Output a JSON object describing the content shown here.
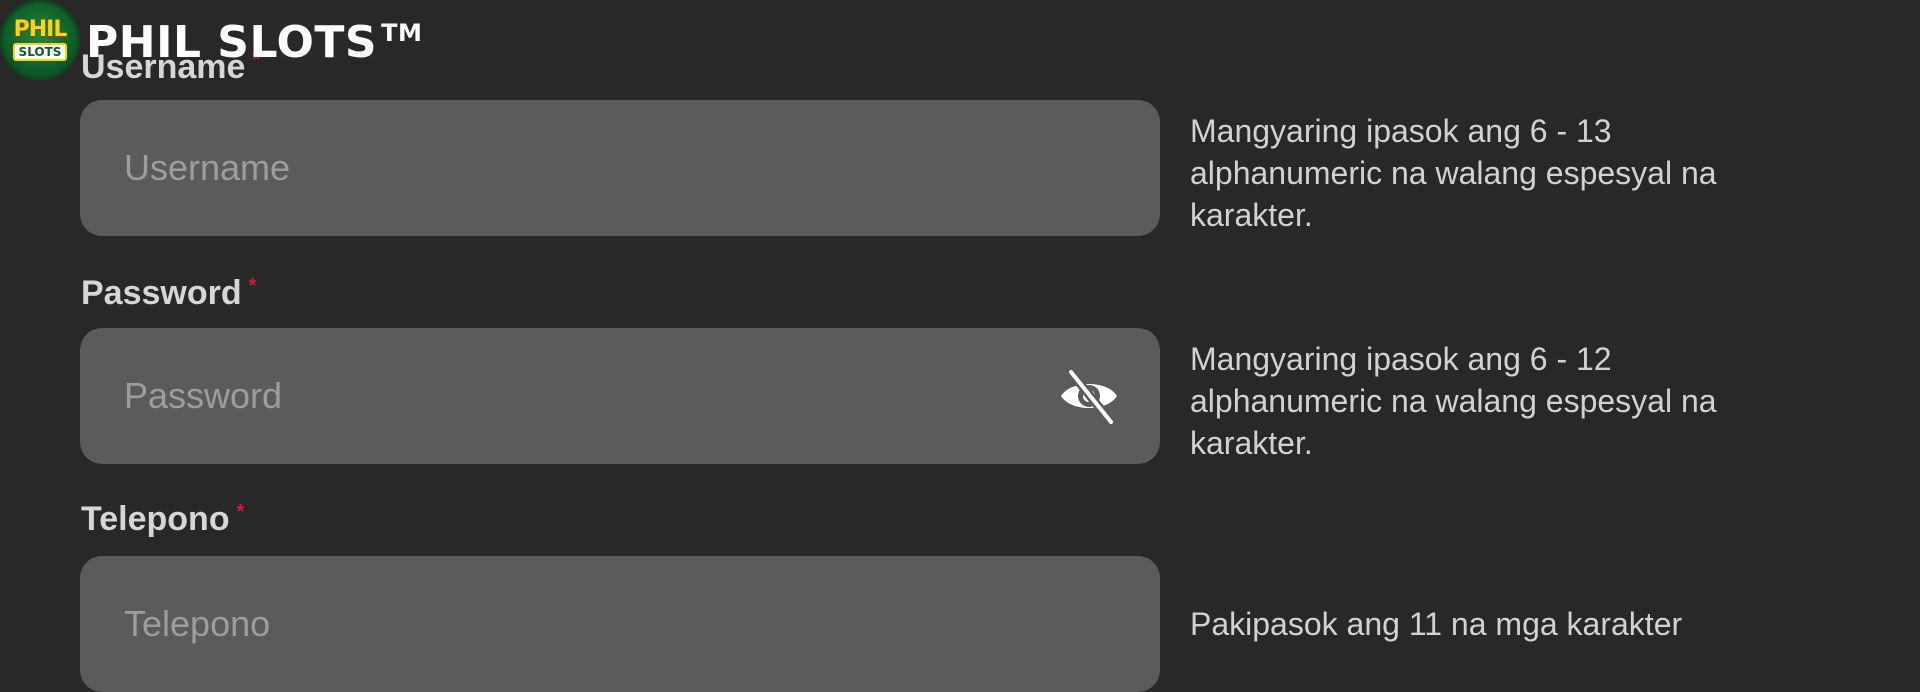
{
  "brand": {
    "logo_top": "PHIL",
    "logo_bottom": "SLOTS",
    "name": "PHIL SLOTS",
    "trademark": "TM"
  },
  "form": {
    "username": {
      "label": "Username",
      "required_mark": "*",
      "placeholder": "Username",
      "hint": "Mangyaring ipasok ang 6 - 13 alphanumeric na walang espesyal na karakter."
    },
    "password": {
      "label": "Password",
      "required_mark": "*",
      "placeholder": "Password",
      "hint": "Mangyaring ipasok ang 6 - 12 alphanumeric na walang espesyal na karakter.",
      "toggle_icon": "eye-off-icon"
    },
    "phone": {
      "label": "Telepono",
      "required_mark": "*",
      "placeholder": "Telepono",
      "hint": "Pakipasok ang 11 na mga karakter"
    }
  },
  "colors": {
    "background": "#282828",
    "input_background": "#5b5b5b",
    "label": "#d6d6d6",
    "required": "#d8163c",
    "hint": "#d2d2d2",
    "placeholder": "#9d9d9d"
  }
}
